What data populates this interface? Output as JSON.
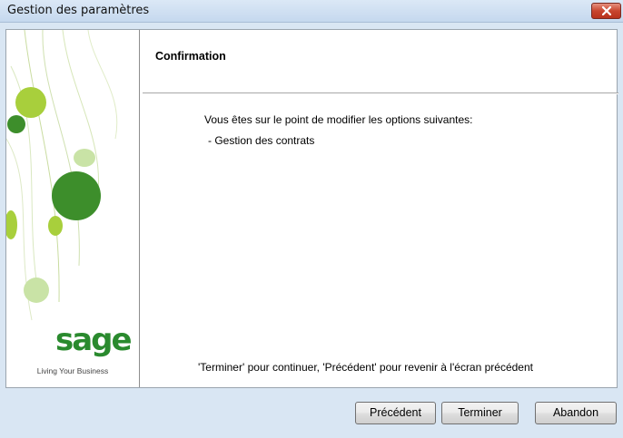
{
  "window": {
    "title": "Gestion des paramètres"
  },
  "page": {
    "heading": "Confirmation",
    "intro": "Vous êtes sur le point de modifier les options suivantes:",
    "options": [
      "- Gestion des contrats"
    ],
    "footer": "'Terminer' pour continuer, 'Précédent' pour revenir à l'écran précédent"
  },
  "sidebar": {
    "logo": "sage",
    "tagline": "Living Your Business",
    "colors": {
      "logo": "#2a8a2e",
      "leaf_light": "#a8cf3c",
      "leaf_dark": "#3d8e2b"
    }
  },
  "buttons": {
    "previous": "Précédent",
    "finish": "Terminer",
    "cancel": "Abandon"
  }
}
